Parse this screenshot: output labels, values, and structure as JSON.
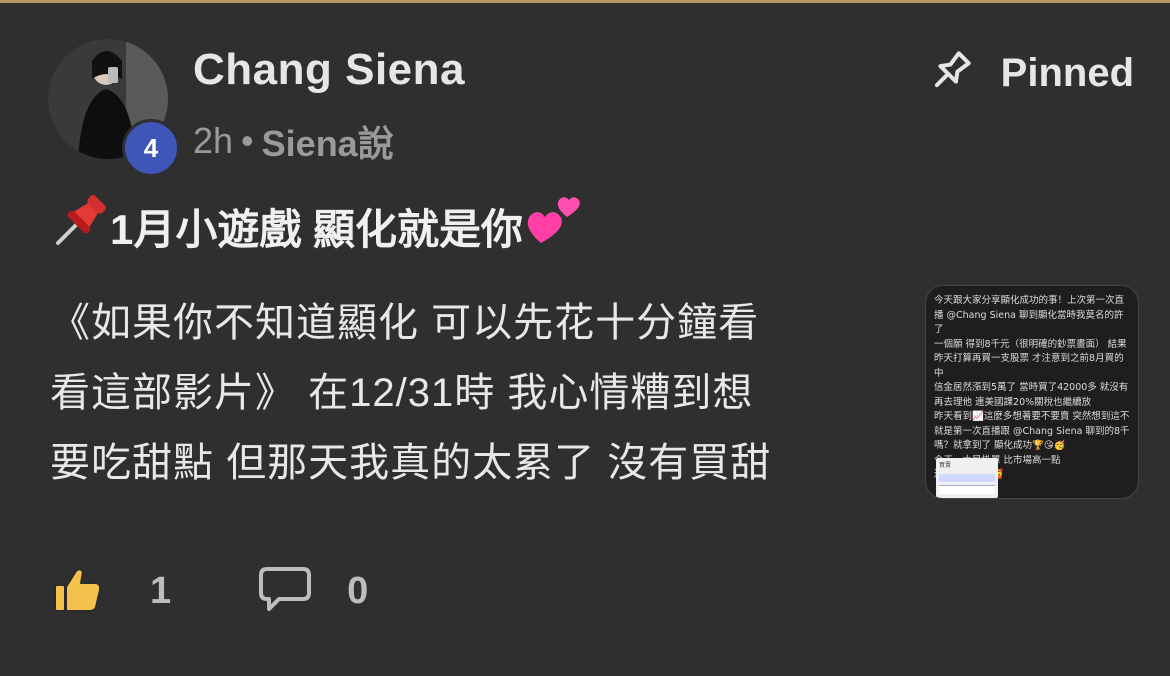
{
  "post": {
    "author": "Chang Siena",
    "time": "2h",
    "separator": "•",
    "group": "Siena說",
    "badge_count": "4",
    "pinned_label": "Pinned",
    "title": "1月小遊戲 顯化就是你",
    "body_lines": [
      "《如果你不知道顯化 可以先花十分鐘看",
      "看這部影片》 在12/31時 我心情糟到想",
      "要吃甜點 但那天我真的太累了 沒有買甜"
    ]
  },
  "thumbnail": {
    "lines": [
      "今天跟大家分享顯化成功的事！上次第一次直",
      "播 @Chang Siena 聊到顯化當時我莫名的許了",
      "一個願 得到8千元（很明確的鈔票畫面） 結果",
      "昨天打算再買一支股票 才注意到之前8月買的中",
      "信金居然漲到5萬了 當時買了42000多 就沒有",
      "再去理他 連美國課20%關稅也繼續放",
      "昨天看到📈這麼多想著要不要賣 突然想到這不",
      "就是第一次直播跟 @Chang Siena 聊到的8千",
      "嗎？就拿到了 顯化成功🏆😘🥳",
      "今天一大早掛單 比市場高一點",
      "還是成交～～🥰"
    ],
    "table_label": "買賣"
  },
  "actions": {
    "like_count": "1",
    "comment_count": "0"
  },
  "colors": {
    "background": "#2f2f2f",
    "top_rule": "#b49a63",
    "badge": "#3f55b8",
    "text_primary": "#e8e8e8",
    "text_muted": "#9a9a9a",
    "like_icon": "#f4c14a"
  },
  "icons": {
    "pin": "pin-icon",
    "like": "thumbs-up-icon",
    "comment": "comment-icon"
  }
}
